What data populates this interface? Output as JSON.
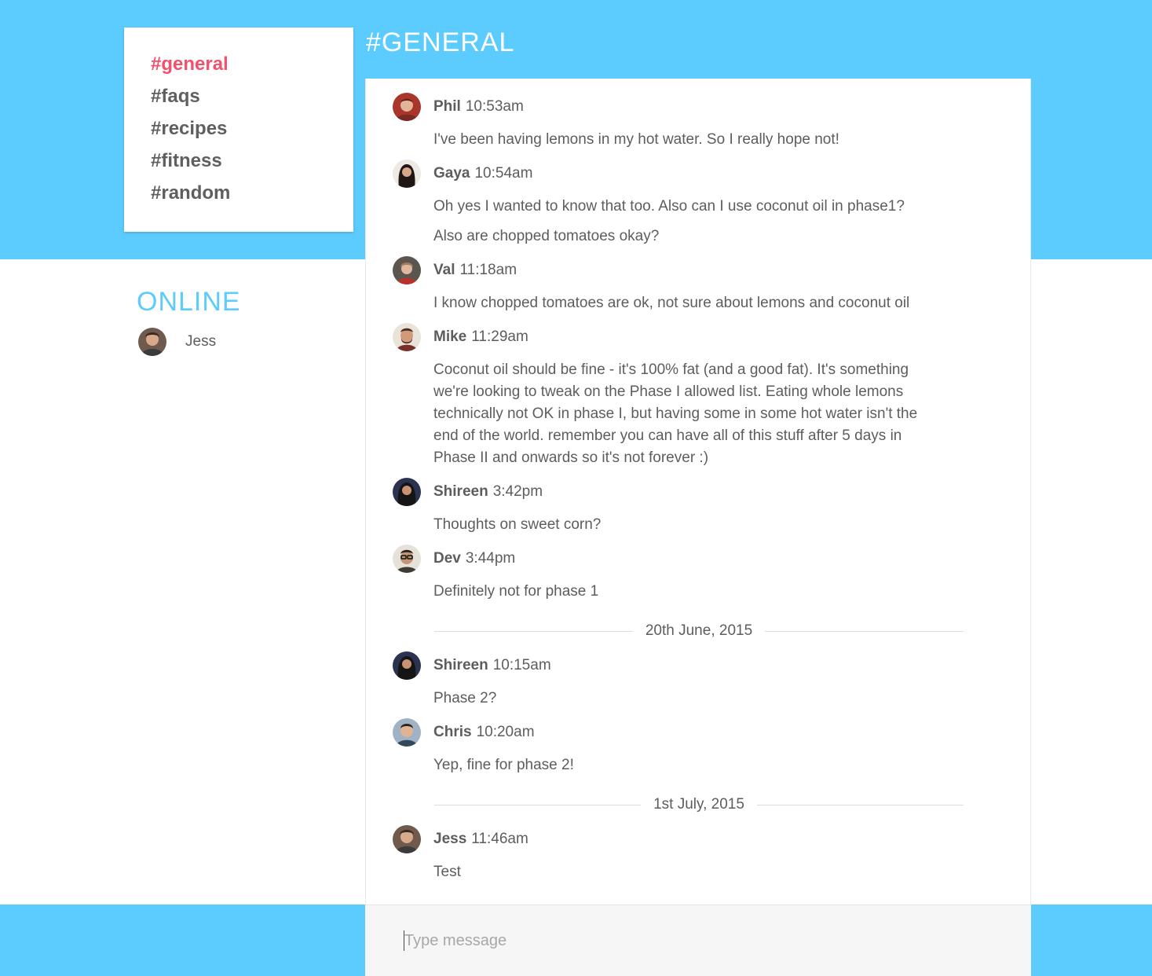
{
  "colors": {
    "brand_blue": "#5ccbfd",
    "active_channel": "#f4506b",
    "text": "#5d5d5d"
  },
  "channels": [
    {
      "label": "#general",
      "active": true
    },
    {
      "label": "#faqs",
      "active": false
    },
    {
      "label": "#recipes",
      "active": false
    },
    {
      "label": "#fitness",
      "active": false
    },
    {
      "label": "#random",
      "active": false
    }
  ],
  "header": {
    "title": "#GENERAL"
  },
  "online": {
    "title": "ONLINE",
    "users": [
      {
        "name": "Jess",
        "avatar_icon": "user-avatar-icon"
      }
    ]
  },
  "messages": [
    {
      "author": "Phil",
      "time": "10:53am",
      "lines": [
        "I've been having lemons in my hot water. So I really hope not!"
      ]
    },
    {
      "author": "Gaya",
      "time": "10:54am",
      "lines": [
        "Oh yes I wanted to know that too. Also can I use coconut oil in phase1?",
        "Also are chopped tomatoes okay?"
      ]
    },
    {
      "author": "Val",
      "time": "11:18am",
      "lines": [
        "I know chopped tomatoes are ok, not sure about lemons and coconut oil"
      ]
    },
    {
      "author": "Mike",
      "time": "11:29am",
      "lines": [
        "Coconut oil should be fine - it's 100% fat (and a good fat). It's something",
        "we're looking to tweak on the Phase I allowed list. Eating whole lemons",
        "technically not OK in phase I, but having some in some hot water isn't the",
        "end of the world. remember you can have all of this stuff after 5 days in",
        "Phase II and onwards so it's not forever :)"
      ]
    },
    {
      "author": "Shireen",
      "time": "3:42pm",
      "lines": [
        "Thoughts on sweet corn?"
      ]
    },
    {
      "author": "Dev",
      "time": "3:44pm",
      "lines": [
        "Definitely not for phase 1"
      ]
    },
    {
      "author": "Shireen",
      "time": "10:15am",
      "lines": [
        "Phase 2?"
      ]
    },
    {
      "author": "Chris",
      "time": "10:20am",
      "lines": [
        "Yep, fine for phase 2!"
      ]
    },
    {
      "author": "Jess",
      "time": "11:46am",
      "lines": [
        "Test"
      ]
    }
  ],
  "date_dividers": [
    "20th June, 2015",
    "1st July, 2015"
  ],
  "composer": {
    "placeholder": "Type message",
    "value": ""
  }
}
